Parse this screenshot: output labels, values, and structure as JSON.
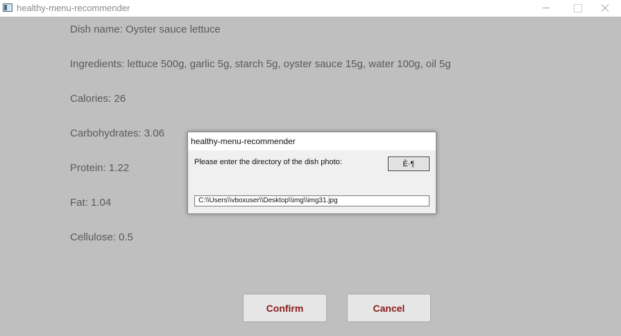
{
  "window": {
    "title": "healthy-menu-recommender"
  },
  "dish": {
    "name": "Dish name: Oyster sauce lettuce",
    "ingredients": "Ingredients: lettuce 500g, garlic 5g, starch 5g, oyster sauce 15g, water 100g, oil 5g",
    "calories": "Calories: 26",
    "carbohydrates": "Carbohydrates: 3.06",
    "protein": "Protein: 1.22",
    "fat": "Fat: 1.04",
    "cellulose": "Cellulose: 0.5"
  },
  "buttons": {
    "confirm_label": "Confirm",
    "cancel_label": "Cancel"
  },
  "dialog": {
    "title": "healthy-menu-recommender",
    "prompt": "Please enter the directory of the dish photo:",
    "ok_label": "È·¶",
    "input_value": "C:\\\\Users\\\\vboxuser\\\\Desktop\\\\img\\\\img31.jpg"
  }
}
